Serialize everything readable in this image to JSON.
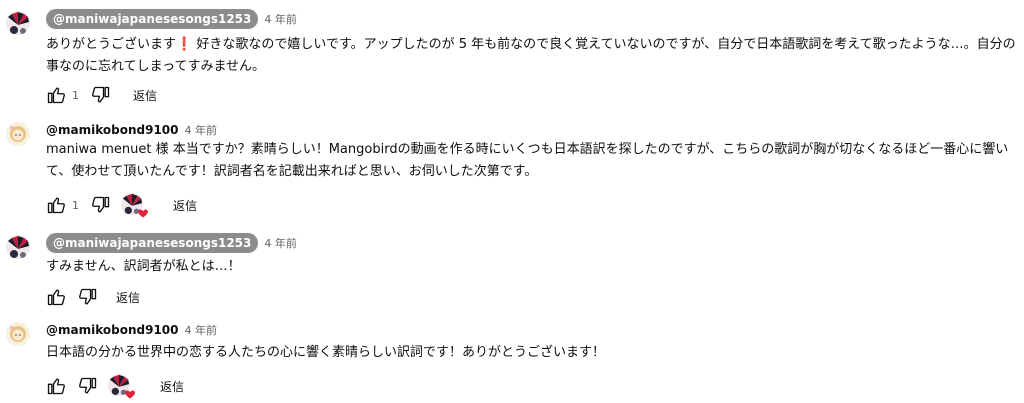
{
  "comments": [
    {
      "author": "@maniwajapanesesongs1253",
      "time": "4 年前",
      "text_part1": "ありがとうございます",
      "exclaim": "❗",
      "text_part2": " 好きな歌なので嬉しいです。アップしたのが 5 年も前なので良く覚えていないのですが、自分で日本語歌詞を考えて歌ったような…。自分の事なのに忘れてしまってすみません。",
      "likes": "1",
      "reply": "返信"
    },
    {
      "author": "@mamikobond9100",
      "time": "4 年前",
      "text": "maniwa menuet 様 本当ですか？素晴らしい！Mangobirdの動画を作る時にいくつも日本語訳を探したのですが、こちらの歌詞が胸が切なくなるほど一番心に響いて、使わせて頂いたんです！訳詞者名を記載出来ればと思い、お伺いした次第です。",
      "likes": "1",
      "reply": "返信"
    },
    {
      "author": "@maniwajapanesesongs1253",
      "time": "4 年前",
      "text": "すみません、訳詞者が私とは…！",
      "reply": "返信"
    },
    {
      "author": "@mamikobond9100",
      "time": "4 年前",
      "text": "日本語の分かる世界中の恋する人たちの心に響く素晴らしい訳詞です！ありがとうございます！",
      "reply": "返信"
    }
  ],
  "icons": {
    "like": "thumbs-up-icon",
    "dislike": "thumbs-down-icon",
    "heart": "heart-icon"
  },
  "colors": {
    "chip": "#8c8c8c",
    "heart": "#e0243a"
  }
}
